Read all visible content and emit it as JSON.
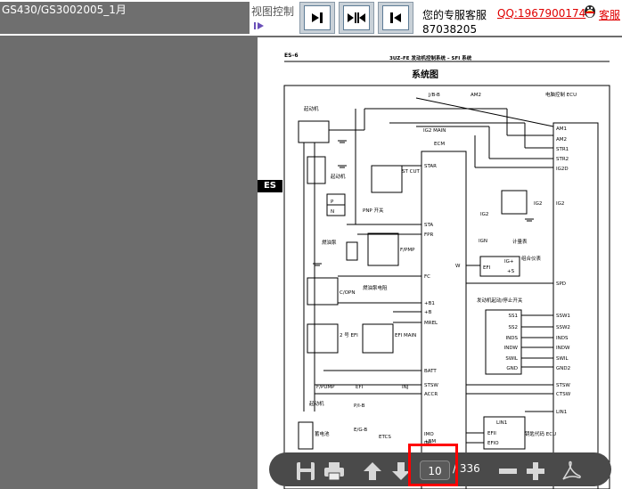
{
  "doc_title": "GS430/GS3002005_1月",
  "view_label": "视图控制",
  "service": {
    "text": "您的专服客服",
    "qq": "QQ:1967900174",
    "service2": "客服",
    "phone": "87038205"
  },
  "side_tab": "ES",
  "pdf": {
    "page_id": "ES–6",
    "header": "3UZ–FE 发动机控制系统 – SFI 系统",
    "title": "系统图",
    "labels": {
      "ecu": "电脑控制 ECU",
      "starter": "起动机",
      "starter2": "起动机",
      "jb": "J/B-B",
      "am2_fuse": "AM2",
      "ig2main": "IG2 MAIN",
      "ecm": "ECM",
      "st_cut": "ST CUT",
      "pnp": "PNP 开关",
      "p": "P",
      "n": "N",
      "fuel_pump": "燃油泵",
      "fpmp": "F/PMP",
      "fuel_pump_resistor": "燃油泵电阻",
      "copn": "C/OPN",
      "no2_efi": "2 号 EFI",
      "efi_main": "EFI MAIN",
      "fpump": "F/PUMP",
      "efi": "EFI",
      "inj": "INJ",
      "starter3": "起动机",
      "pig": "P/I-B",
      "eig": "E/G-B",
      "etcs": "ETCS",
      "battery": "蓄电池",
      "ig2": "IG2",
      "ign": "IGN",
      "meter": "计量表",
      "combo_meter": "组合仪表",
      "w": "W",
      "efi_small": "EFI",
      "ig_plus": "IG+",
      "plus_s": "+S",
      "engine_start_switch": "发动机起动/停止开关",
      "lin1": "LIN1",
      "efii": "EFII",
      "efio": "EFIO",
      "key_code_ecu": "钥匙代码 ECU"
    },
    "ecm_pins": [
      "STAR",
      "STA",
      "FPR",
      "FC",
      "+B1",
      "+B",
      "MREL",
      "BATT",
      "STSW",
      "ACCR",
      "IMO",
      "IMI",
      "+BM"
    ],
    "right_pins": [
      "AM1",
      "AM2",
      "STR1",
      "STR2",
      "IG2D",
      "IG2",
      "SPD",
      "SSW1",
      "SSW2",
      "INDS",
      "INDW",
      "SWIL",
      "GND2",
      "STSW",
      "CTSW",
      "LIN1"
    ],
    "switch_pins": [
      "SS1",
      "SS2",
      "INDS",
      "INDW",
      "SWIL",
      "GND"
    ]
  },
  "toolbar": {
    "current_page": "10",
    "total_pages": "/ 336"
  },
  "colors": {
    "background": "#6d6d6d",
    "toolbar": "#4a4a4a",
    "highlight": "#ff0000",
    "qq_link": "#e00000"
  }
}
